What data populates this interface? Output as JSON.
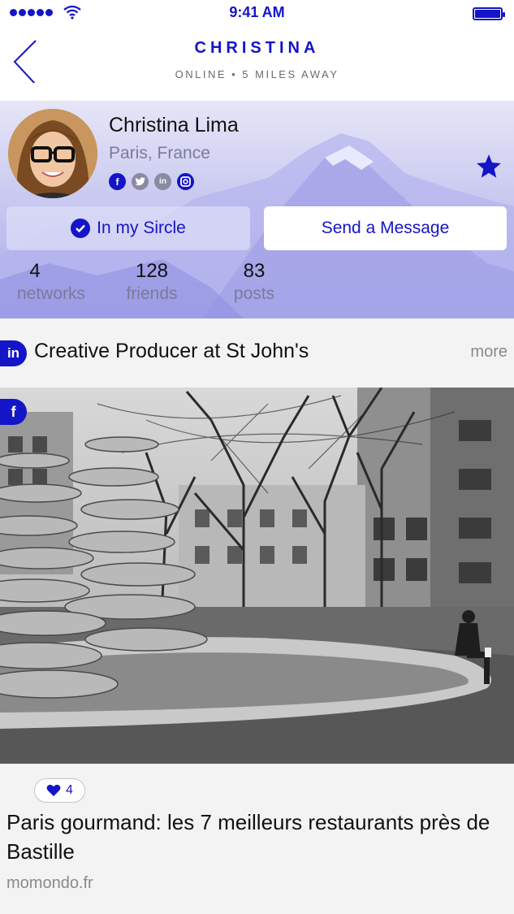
{
  "status_bar": {
    "time": "9:41 AM",
    "icons": [
      "signal-icon",
      "wifi-icon",
      "battery-icon"
    ]
  },
  "header": {
    "back_icon": "chevron-left-icon",
    "title": "CHRISTINA",
    "subtitle": "ONLINE • 5 MILES AWAY"
  },
  "profile": {
    "name": "Christina Lima",
    "location": "Paris, France",
    "socials": [
      {
        "icon": "facebook-icon",
        "glyph": "f"
      },
      {
        "icon": "twitter-icon",
        "glyph": ""
      },
      {
        "icon": "linkedin-icon",
        "glyph": "in"
      },
      {
        "icon": "instagram-icon",
        "glyph": ""
      }
    ],
    "favorite_icon": "star-icon",
    "sircle_label": "In my Sircle",
    "message_label": "Send a Message",
    "stats": [
      {
        "value": "4",
        "label": "networks"
      },
      {
        "value": "128",
        "label": "friends"
      },
      {
        "value": "83",
        "label": "posts"
      }
    ]
  },
  "job": {
    "badge": "in",
    "title": "Creative Producer at St John's",
    "more_label": "more"
  },
  "post": {
    "badge": "f",
    "likes": "4",
    "title": "Paris gourmand: les 7 meilleurs restaurants près de Bastille",
    "source": "momondo.fr"
  },
  "colors": {
    "accent": "#1414c8",
    "muted_text": "#7a7a9a",
    "panel_bg": "#f3f3f4"
  }
}
